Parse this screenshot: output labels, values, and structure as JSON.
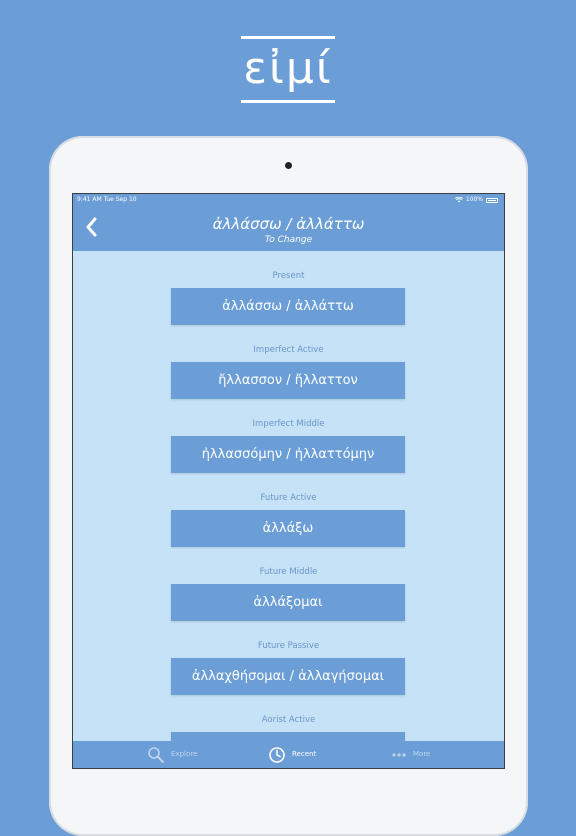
{
  "brand": {
    "text": "εἰμί"
  },
  "status_bar": {
    "time_date": "9:41 AM  Tue Sep 10",
    "battery": "100%"
  },
  "header": {
    "title": "ἀλλάσσω / ἀλλάττω",
    "subtitle": "To Change"
  },
  "forms": [
    {
      "label": "Present",
      "value": "ἀλλάσσω / ἀλλάττω"
    },
    {
      "label": "Imperfect Active",
      "value": "ἤλλασσον / ἤλλαττον"
    },
    {
      "label": "Imperfect Middle",
      "value": "ἠλλασσόμην / ἠλλαττόμην"
    },
    {
      "label": "Future Active",
      "value": "ἀλλάξω"
    },
    {
      "label": "Future Middle",
      "value": "ἀλλάξομαι"
    },
    {
      "label": "Future Passive",
      "value": "ἀλλαχθήσομαι / ἀλλαγήσομαι"
    },
    {
      "label": "Aorist Active",
      "value": ""
    }
  ],
  "tab_bar": {
    "tabs": [
      {
        "label": "Explore",
        "icon": "search-icon",
        "active": false
      },
      {
        "label": "Recent",
        "icon": "clock-icon",
        "active": true
      },
      {
        "label": "More",
        "icon": "more-dots-icon",
        "active": false
      }
    ]
  },
  "colors": {
    "accent": "#6b9ed6",
    "content_bg": "#c5e2f7",
    "label": "#6b94c8"
  }
}
